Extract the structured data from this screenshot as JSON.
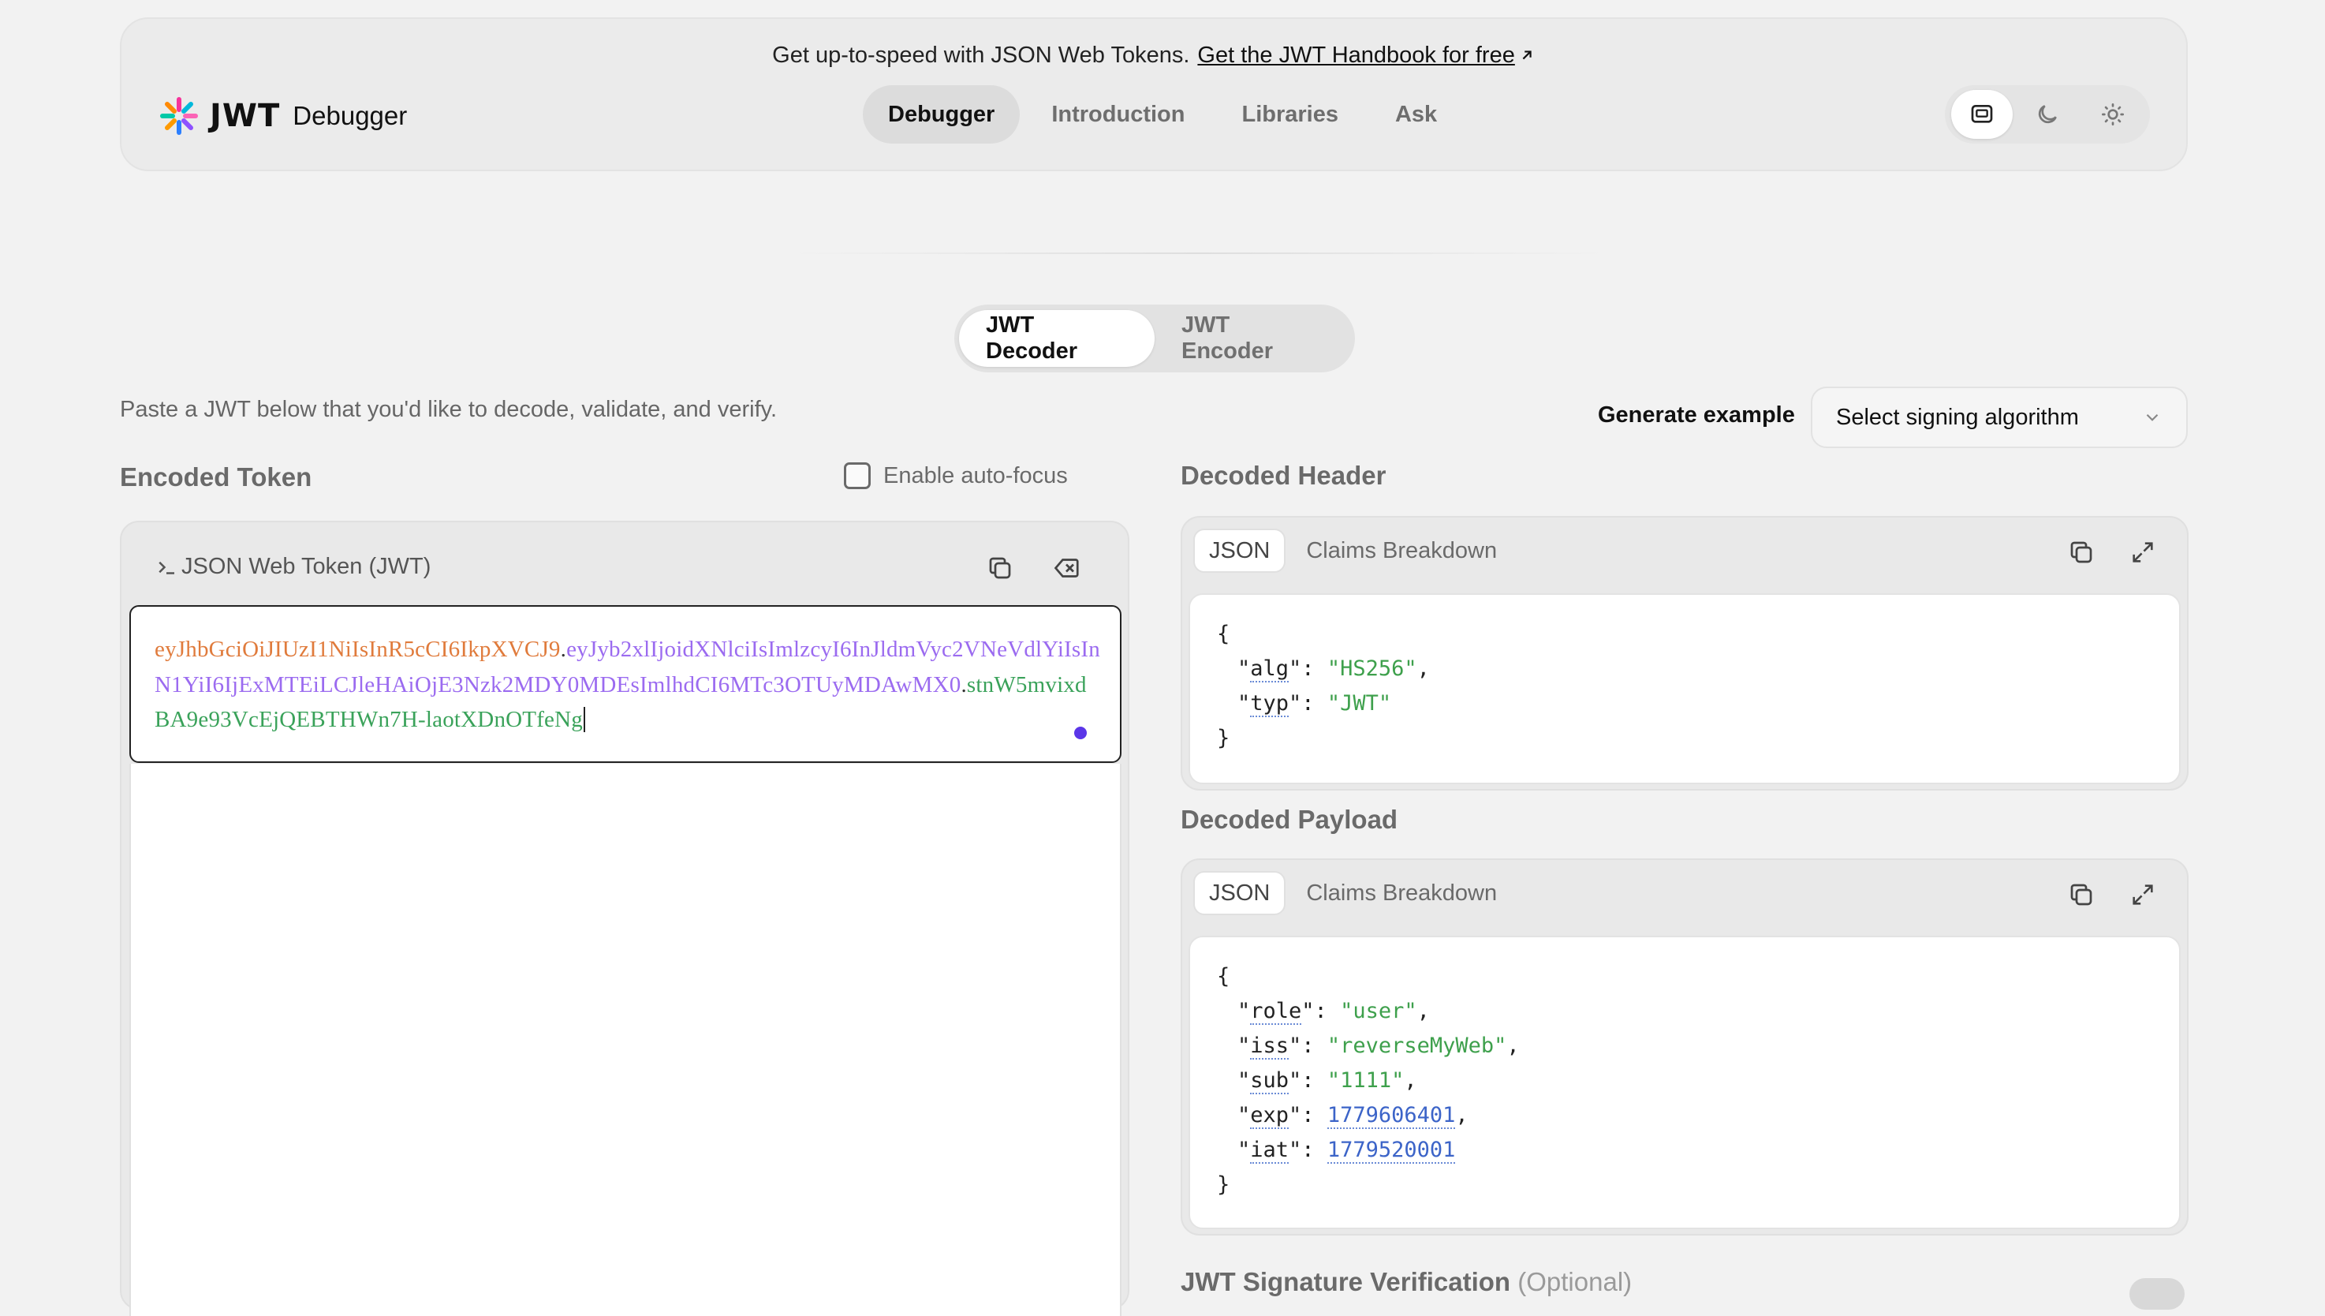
{
  "banner": {
    "text": "Get up-to-speed with JSON Web Tokens.",
    "link": "Get the JWT Handbook for free"
  },
  "logo": {
    "mark": "JWT",
    "title": "Debugger"
  },
  "nav": [
    {
      "label": "Debugger",
      "active": true
    },
    {
      "label": "Introduction"
    },
    {
      "label": "Libraries"
    },
    {
      "label": "Ask"
    }
  ],
  "theme_icons": [
    "system-theme-icon",
    "moon-icon",
    "sun-icon"
  ],
  "tabs": [
    {
      "label": "JWT Decoder",
      "active": true
    },
    {
      "label": "JWT Encoder"
    }
  ],
  "intro": "Paste a JWT below that you'd like to decode, validate, and verify.",
  "generate": {
    "label": "Generate example",
    "select_value": "Select signing algorithm"
  },
  "encoded": {
    "title": "Encoded Token",
    "autofocus_label": "Enable auto-focus",
    "panel_label": "JSON Web Token (JWT)",
    "token_header": "eyJhbGciOiJIUzI1NiIsInR5cCI6IkpXVCJ9",
    "token_payload": "eyJyb2xlIjoidXNlciIsImlzcyI6InJldmVyc2VNeVdlYiIsInN1YiI6IjExMTEiLCJleHAiOjE3Nzk2MDY0MDEsImlhdCI6MTc3OTUyMDAwMX0",
    "token_signature": "stnW5mvixdBA9e93VcEjQEBTHWn7H-laotXDnOTfeNg"
  },
  "decoded_header": {
    "title": "Decoded Header",
    "tab_json": "JSON",
    "tab_claims": "Claims Breakdown",
    "lines": [
      {
        "key": "alg",
        "value": "\"HS256\"",
        "comma": ","
      },
      {
        "key": "typ",
        "value": "\"JWT\"",
        "comma": ""
      }
    ]
  },
  "decoded_payload": {
    "title": "Decoded Payload",
    "tab_json": "JSON",
    "tab_claims": "Claims Breakdown",
    "lines": [
      {
        "key": "role",
        "value": "\"user\"",
        "comma": ","
      },
      {
        "key": "iss",
        "value": "\"reverseMyWeb\"",
        "comma": ","
      },
      {
        "key": "sub",
        "value": "\"1111\"",
        "comma": ","
      },
      {
        "key": "exp",
        "value": "1779606401",
        "comma": ",",
        "numeric": true
      },
      {
        "key": "iat",
        "value": "1779520001",
        "comma": "",
        "numeric": true
      }
    ]
  },
  "signature": {
    "title": "JWT Signature Verification",
    "optional": "(Optional)"
  },
  "colors": {
    "header_part": "#e07b3c",
    "payload_part": "#9b6bf0",
    "signature_part": "#3aa25a",
    "accent": "#5b36e8"
  }
}
